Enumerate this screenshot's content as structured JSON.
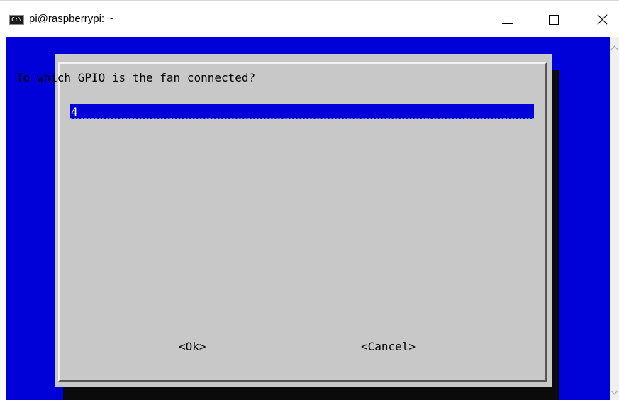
{
  "window": {
    "title": "pi@raspberrypi: ~",
    "icon_text": "C:\\.",
    "icon": "console-icon",
    "controls": [
      "minimize-icon",
      "maximize-icon",
      "close-icon"
    ]
  },
  "dialog": {
    "prompt": "To which GPIO is the fan connected?",
    "input_value": "4",
    "ok_label": "<Ok>",
    "cancel_label": "<Cancel>"
  },
  "colors": {
    "terminal_bg": "#0000d8",
    "dialog_bg": "#c8c8c8",
    "input_bg": "#0000d8",
    "shadow": "#0b0b0b"
  }
}
